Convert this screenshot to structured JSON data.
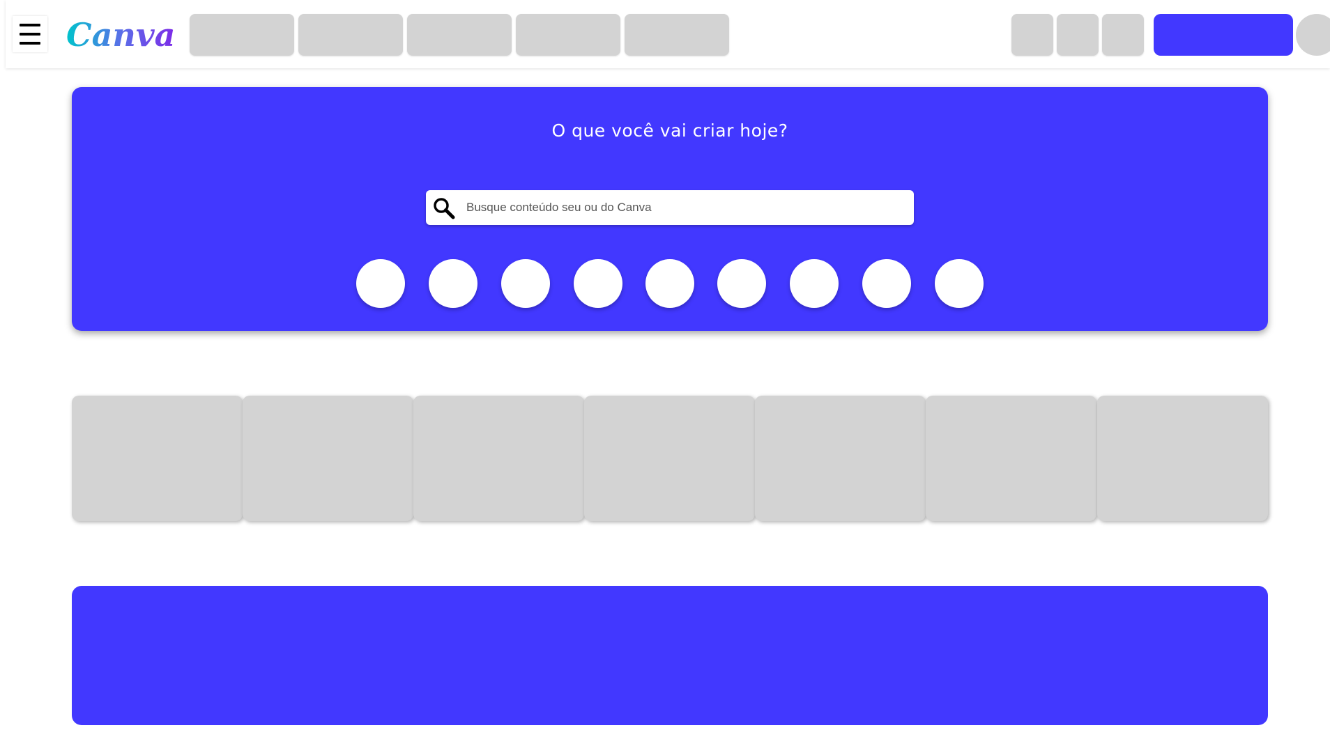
{
  "app": {
    "logo_text": "Canva"
  },
  "header": {
    "menu_icon": "hamburger-menu-icon",
    "nav_tabs": [
      {},
      {},
      {},
      {},
      {}
    ],
    "action_buttons": [
      {},
      {},
      {}
    ],
    "colors": {
      "primary": "#4238ff",
      "placeholder_gray": "#d3d3d3"
    }
  },
  "hero": {
    "title": "O que você vai criar hoje?",
    "search": {
      "placeholder": "Busque conteúdo seu ou do Canva",
      "value": "",
      "icon": "search-icon"
    },
    "shortcuts": [
      {},
      {},
      {},
      {},
      {},
      {},
      {},
      {},
      {}
    ]
  },
  "cards": [
    {},
    {},
    {},
    {},
    {},
    {},
    {}
  ],
  "banner": {}
}
